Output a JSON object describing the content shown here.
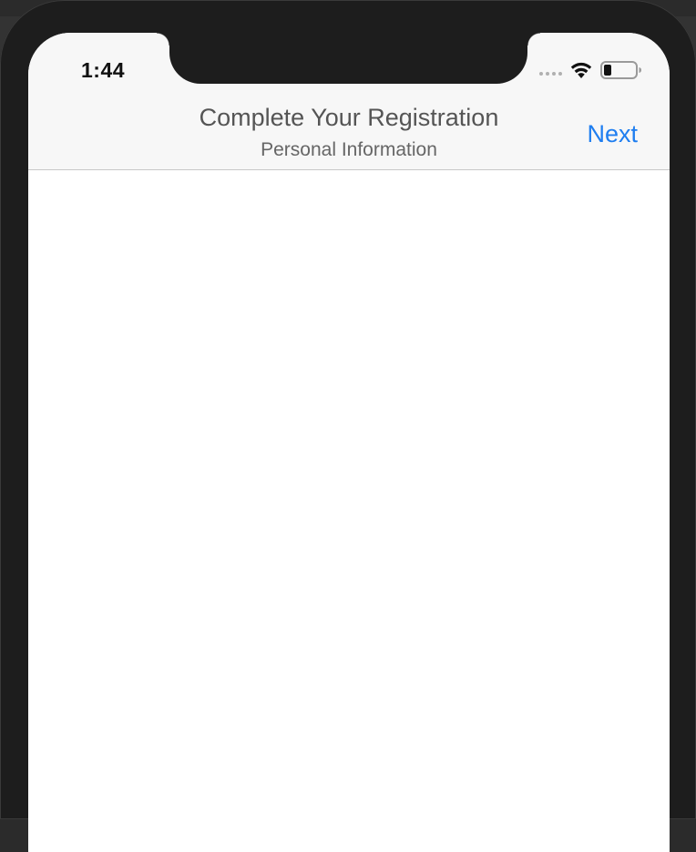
{
  "status_bar": {
    "time": "1:44",
    "signal_icon": "signal-dots-icon",
    "wifi_icon": "wifi-icon",
    "battery_icon": "battery-icon"
  },
  "nav_bar": {
    "title": "Complete Your Registration",
    "subtitle": "Personal Information",
    "next_label": "Next"
  },
  "colors": {
    "accent": "#1f7ef0",
    "nav_background": "#f7f7f7",
    "title_text": "#555555",
    "device_frame": "#1d1d1d"
  }
}
